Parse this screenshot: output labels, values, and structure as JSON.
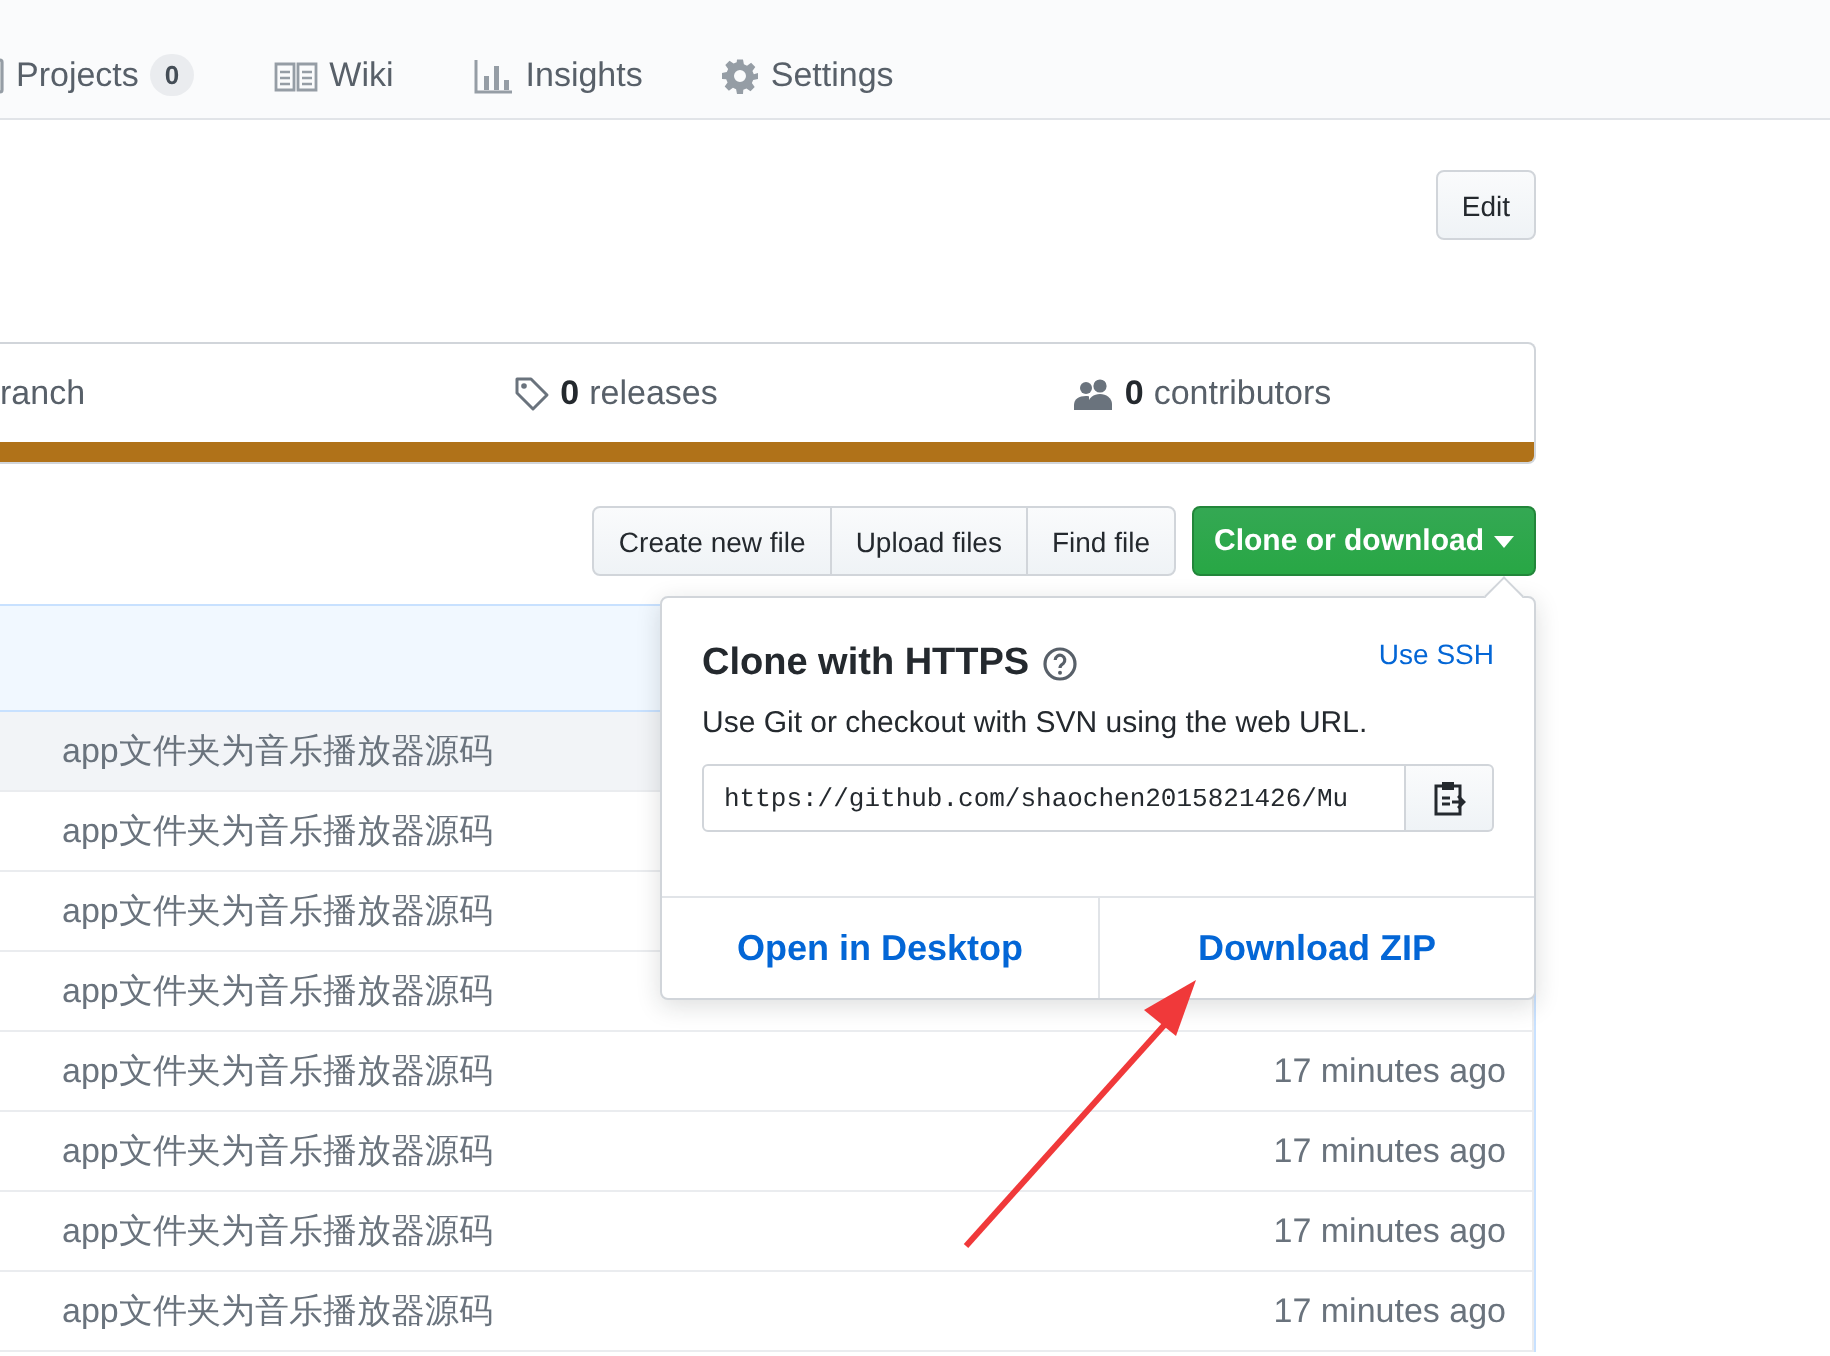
{
  "nav": {
    "tabs": [
      {
        "kind": "project",
        "label": "Projects",
        "count": "0"
      },
      {
        "kind": "book",
        "label": "Wiki"
      },
      {
        "kind": "graph",
        "label": "Insights"
      },
      {
        "kind": "gear",
        "label": "Settings"
      }
    ]
  },
  "edit_button": "Edit",
  "stats": [
    {
      "label": "ranch"
    },
    {
      "kind": "tag",
      "count": "0",
      "label": "releases"
    },
    {
      "kind": "people",
      "count": "0",
      "label": "contributors"
    }
  ],
  "file_actions": [
    "Create new file",
    "Upload files",
    "Find file"
  ],
  "clone_button": "Clone or download",
  "clone_popup": {
    "title": "Clone with HTTPS",
    "switch_link": "Use SSH",
    "description": "Use Git or checkout with SVN using the web URL.",
    "url": "https://github.com/shaochen2015821426/Mu",
    "actions": [
      "Open in Desktop",
      "Download ZIP"
    ]
  },
  "files": [
    {
      "message": "app文件夹为音乐播放器源码",
      "hovered": true
    },
    {
      "message": "app文件夹为音乐播放器源码",
      "hovered": false
    },
    {
      "message": "app文件夹为音乐播放器源码",
      "hovered": false
    },
    {
      "message": "app文件夹为音乐播放器源码",
      "hovered": false
    },
    {
      "message": "app文件夹为音乐播放器源码",
      "age": "17 minutes ago",
      "hovered": false
    },
    {
      "message": "app文件夹为音乐播放器源码",
      "age": "17 minutes ago",
      "hovered": false
    },
    {
      "message": "app文件夹为音乐播放器源码",
      "age": "17 minutes ago",
      "hovered": false
    },
    {
      "message": "app文件夹为音乐播放器源码",
      "age": "17 minutes ago",
      "hovered": false
    }
  ]
}
